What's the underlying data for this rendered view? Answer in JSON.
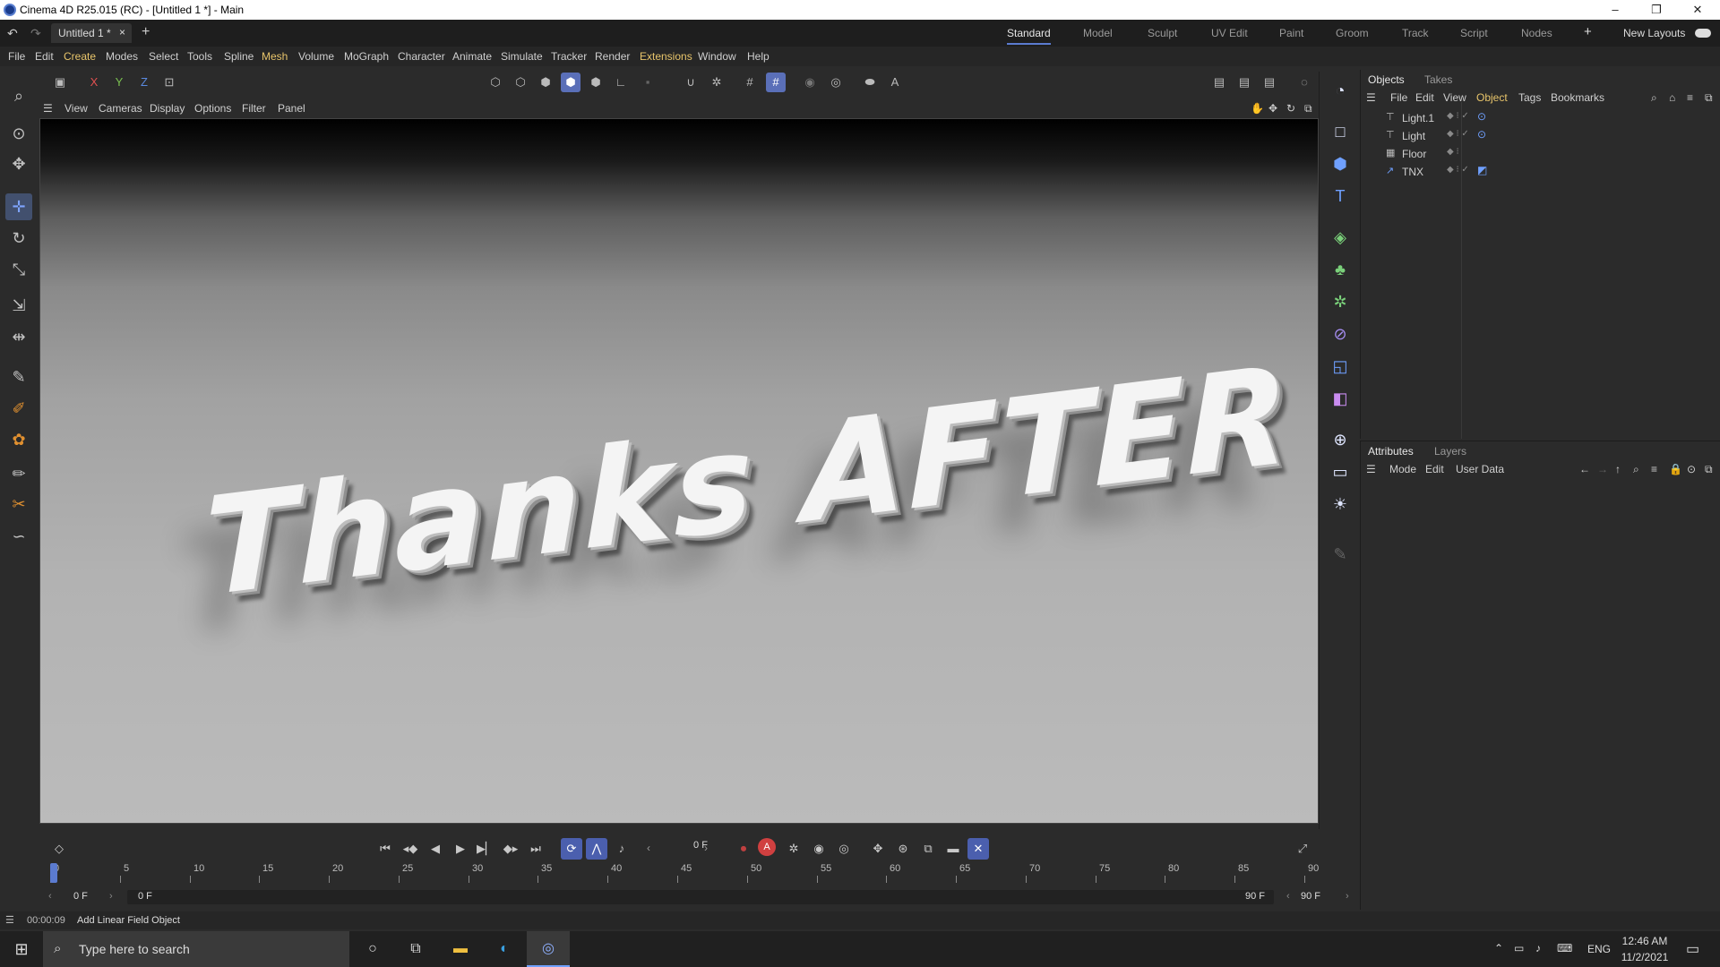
{
  "window": {
    "title": "Cinema 4D R25.015 (RC) - [Untitled 1 *] - Main",
    "minimize": "–",
    "maximize": "❐",
    "close": "✕"
  },
  "doc_tab": {
    "label": "Untitled 1 *",
    "close": "×",
    "add": "+"
  },
  "layouts": {
    "items": [
      "Standard",
      "Model",
      "Sculpt",
      "UV Edit",
      "Paint",
      "Groom",
      "Track",
      "Script",
      "Nodes"
    ],
    "add": "+",
    "new_layouts": "New Layouts"
  },
  "menu": [
    "File",
    "Edit",
    "Create",
    "Modes",
    "Select",
    "Tools",
    "Spline",
    "Mesh",
    "Volume",
    "MoGraph",
    "Character",
    "Animate",
    "Simulate",
    "Tracker",
    "Render",
    "Extensions",
    "Window",
    "Help"
  ],
  "toolbar": {
    "axis_x": "X",
    "axis_y": "Y",
    "axis_z": "Z",
    "ao_label": "A"
  },
  "viewport_menu": [
    "View",
    "Cameras",
    "Display",
    "Options",
    "Filter",
    "Panel"
  ],
  "scene": {
    "text": "Thanks AFTER"
  },
  "objects_panel": {
    "tabs": [
      "Objects",
      "Takes"
    ],
    "menu": [
      "File",
      "Edit",
      "View",
      "Object",
      "Tags",
      "Bookmarks"
    ],
    "items": [
      {
        "name": "Light.1"
      },
      {
        "name": "Light"
      },
      {
        "name": "Floor"
      },
      {
        "name": "TNX"
      }
    ]
  },
  "attributes_panel": {
    "tabs": [
      "Attributes",
      "Layers"
    ],
    "menu": [
      "Mode",
      "Edit",
      "User Data"
    ]
  },
  "timeline": {
    "current_frame": "0 F",
    "ticks": [
      "0",
      "5",
      "10",
      "15",
      "20",
      "25",
      "30",
      "35",
      "40",
      "45",
      "50",
      "55",
      "60",
      "65",
      "70",
      "75",
      "80",
      "85",
      "90"
    ],
    "start": "0 F",
    "range_start": "0 F",
    "range_end": "90 F",
    "end": "90 F"
  },
  "status": {
    "time": "00:00:09",
    "message": "Add Linear Field Object"
  },
  "taskbar": {
    "search_placeholder": "Type here to search",
    "lang": "ENG",
    "time": "12:46 AM",
    "date": "11/2/2021"
  },
  "colors": {
    "accent": "#5a6fb8",
    "highlight": "#e8c56b",
    "icon_blue": "#6fa0ff"
  }
}
